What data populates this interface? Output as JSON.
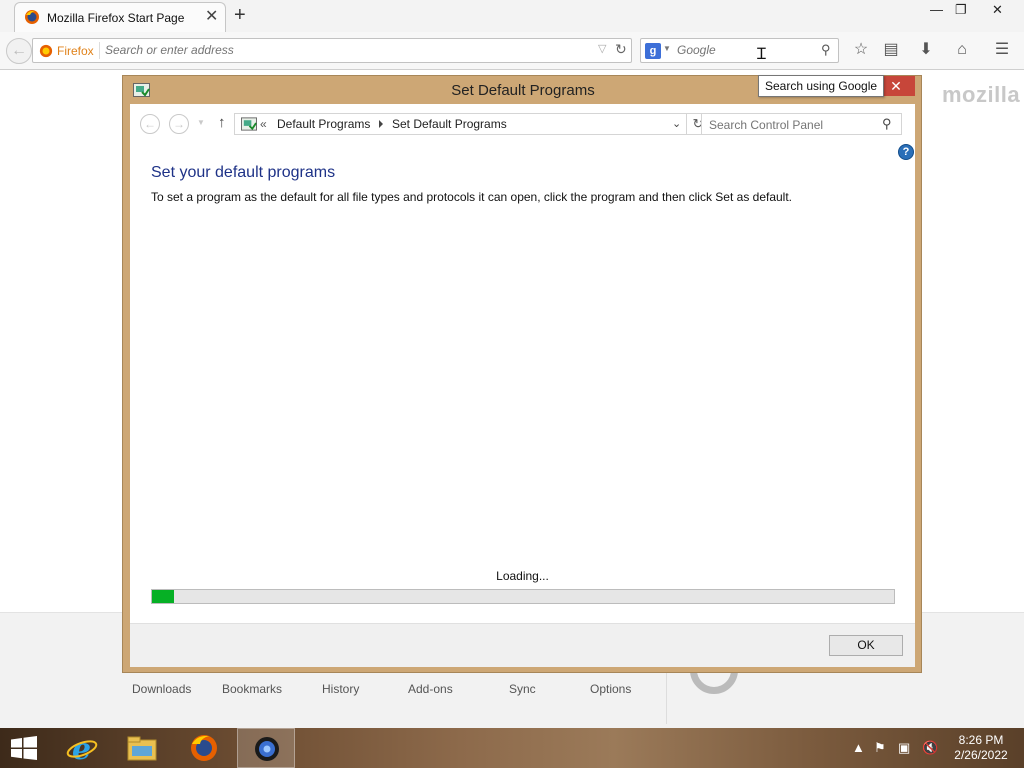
{
  "browser": {
    "tab": {
      "title": "Mozilla Firefox Start Page",
      "close": "✕"
    },
    "new_tab": "+",
    "window_controls": {
      "minimize": "—",
      "restore": "❐",
      "close": "✕"
    },
    "identity_label": "Firefox",
    "url_placeholder": "Search or enter address",
    "search": {
      "engine": "g",
      "placeholder": "Google",
      "tooltip": "Search using Google"
    },
    "icons": [
      "back-icon",
      "reload-icon",
      "bookmark-star-icon",
      "reading-list-icon",
      "download-icon",
      "home-icon",
      "menu-icon"
    ]
  },
  "start_page": {
    "logo": "mozilla",
    "launcher": [
      "Downloads",
      "Bookmarks",
      "History",
      "Add-ons",
      "Sync",
      "Options"
    ]
  },
  "dialog": {
    "title": "Set Default Programs",
    "close": "✕",
    "nav": {
      "back": "←",
      "forward": "→",
      "up": "↑",
      "breadcrumb_prefix": "«",
      "breadcrumbs": [
        "Default Programs",
        "Set Default Programs"
      ],
      "search_placeholder": "Search Control Panel",
      "help": "?"
    },
    "heading": "Set your default programs",
    "description": "To set a program as the default for all file types and protocols it can open, click the program and then click Set as default.",
    "loading_text": "Loading...",
    "progress_percent": 3,
    "ok_label": "OK"
  },
  "taskbar": {
    "apps": [
      "internet-explorer",
      "file-explorer",
      "firefox",
      "control-panel"
    ],
    "active_app": "control-panel",
    "tray_icons": [
      "show-hidden-icons",
      "action-center-flag",
      "network",
      "volume-muted"
    ],
    "time": "8:26 PM",
    "date": "2/26/2022"
  },
  "colors": {
    "dialog_frame": "#cda775",
    "close_button": "#c7463a",
    "heading": "#1e3287",
    "progress_fill": "#06b025"
  }
}
